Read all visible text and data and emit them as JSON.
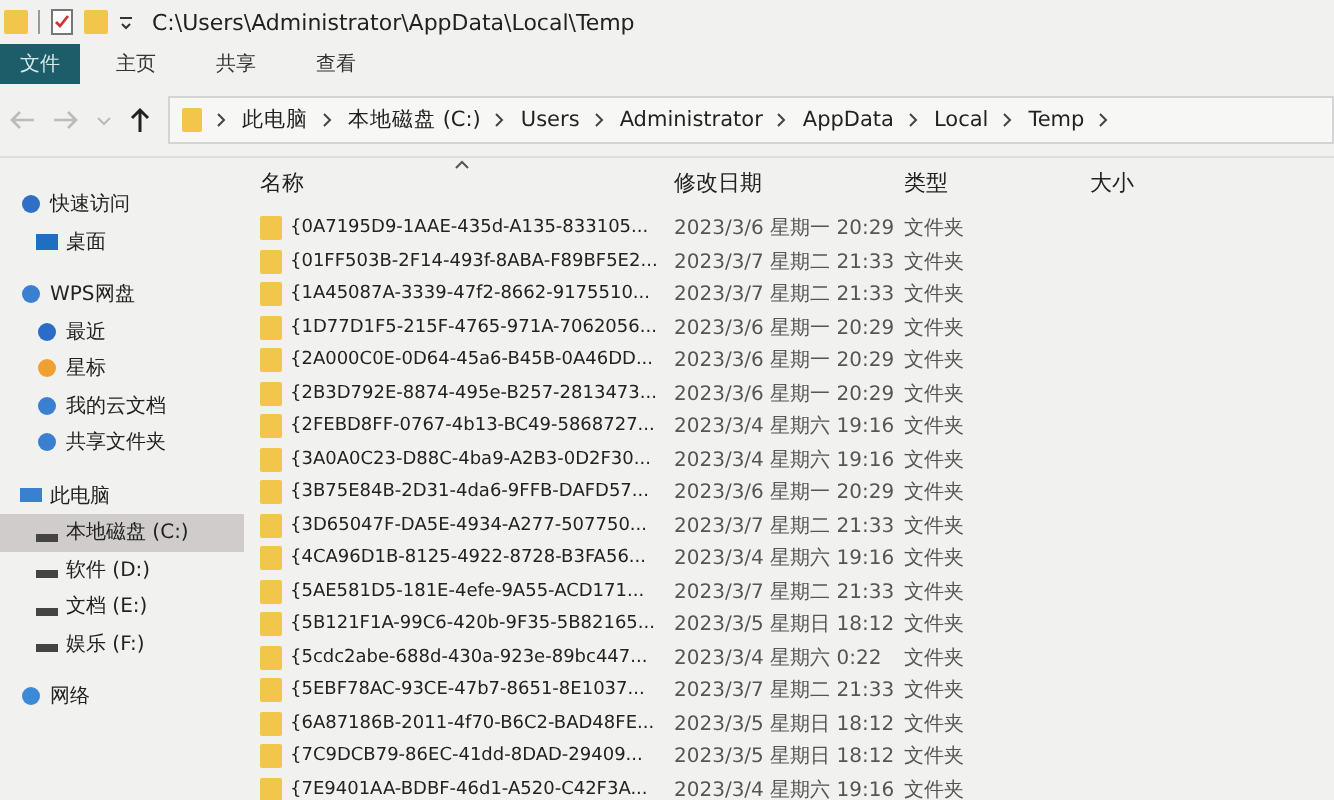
{
  "title_bar": {
    "title": "C:\\Users\\Administrator\\AppData\\Local\\Temp"
  },
  "ribbon_tabs": [
    {
      "label": "文件",
      "selected": true
    },
    {
      "label": "主页",
      "selected": false
    },
    {
      "label": "共享",
      "selected": false
    },
    {
      "label": "查看",
      "selected": false
    }
  ],
  "address_bar": {
    "segments": [
      "此电脑",
      "本地磁盘 (C:)",
      "Users",
      "Administrator",
      "AppData",
      "Local",
      "Temp"
    ]
  },
  "sidebar": [
    {
      "label": "快速访问",
      "kind": "star",
      "selected": false,
      "children": [
        {
          "label": "桌面",
          "kind": "desktop",
          "selected": false
        }
      ]
    },
    {
      "label": "WPS网盘",
      "kind": "cloud",
      "selected": false,
      "children": [
        {
          "label": "最近",
          "kind": "clock",
          "selected": false
        },
        {
          "label": "星标",
          "kind": "star-orange",
          "selected": false
        },
        {
          "label": "我的云文档",
          "kind": "cloud",
          "selected": false
        },
        {
          "label": "共享文件夹",
          "kind": "share",
          "selected": false
        }
      ]
    },
    {
      "label": "此电脑",
      "kind": "pc",
      "selected": false,
      "children": [
        {
          "label": "本地磁盘 (C:)",
          "kind": "drive",
          "selected": true
        },
        {
          "label": "软件 (D:)",
          "kind": "drive",
          "selected": false
        },
        {
          "label": "文档 (E:)",
          "kind": "drive",
          "selected": false
        },
        {
          "label": "娱乐 (F:)",
          "kind": "drive",
          "selected": false
        }
      ]
    },
    {
      "label": "网络",
      "kind": "network",
      "selected": false
    }
  ],
  "columns": [
    {
      "label": "名称",
      "sorted": true
    },
    {
      "label": "修改日期",
      "sorted": false
    },
    {
      "label": "类型",
      "sorted": false
    },
    {
      "label": "大小",
      "sorted": false
    }
  ],
  "rows": [
    {
      "name": "{0A7195D9-1AAE-435d-A135-833105...",
      "modified": "2023/3/6 星期一 20:29",
      "type": "文件夹"
    },
    {
      "name": "{01FF503B-2F14-493f-8ABA-F89BF5E2...",
      "modified": "2023/3/7 星期二 21:33",
      "type": "文件夹"
    },
    {
      "name": "{1A45087A-3339-47f2-8662-9175510...",
      "modified": "2023/3/7 星期二 21:33",
      "type": "文件夹"
    },
    {
      "name": "{1D77D1F5-215F-4765-971A-7062056...",
      "modified": "2023/3/6 星期一 20:29",
      "type": "文件夹"
    },
    {
      "name": "{2A000C0E-0D64-45a6-B45B-0A46DD...",
      "modified": "2023/3/6 星期一 20:29",
      "type": "文件夹"
    },
    {
      "name": "{2B3D792E-8874-495e-B257-2813473...",
      "modified": "2023/3/6 星期一 20:29",
      "type": "文件夹"
    },
    {
      "name": "{2FEBD8FF-0767-4b13-BC49-5868727...",
      "modified": "2023/3/4 星期六 19:16",
      "type": "文件夹"
    },
    {
      "name": "{3A0A0C23-D88C-4ba9-A2B3-0D2F30...",
      "modified": "2023/3/4 星期六 19:16",
      "type": "文件夹"
    },
    {
      "name": "{3B75E84B-2D31-4da6-9FFB-DAFD57...",
      "modified": "2023/3/6 星期一 20:29",
      "type": "文件夹"
    },
    {
      "name": "{3D65047F-DA5E-4934-A277-507750...",
      "modified": "2023/3/7 星期二 21:33",
      "type": "文件夹"
    },
    {
      "name": "{4CA96D1B-8125-4922-8728-B3FA56...",
      "modified": "2023/3/4 星期六 19:16",
      "type": "文件夹"
    },
    {
      "name": "{5AE581D5-181E-4efe-9A55-ACD171...",
      "modified": "2023/3/7 星期二 21:33",
      "type": "文件夹"
    },
    {
      "name": "{5B121F1A-99C6-420b-9F35-5B82165...",
      "modified": "2023/3/5 星期日 18:12",
      "type": "文件夹"
    },
    {
      "name": "{5cdc2abe-688d-430a-923e-89bc447...",
      "modified": "2023/3/4 星期六 0:22",
      "type": "文件夹"
    },
    {
      "name": "{5EBF78AC-93CE-47b7-8651-8E1037...",
      "modified": "2023/3/7 星期二 21:33",
      "type": "文件夹"
    },
    {
      "name": "{6A87186B-2011-4f70-B6C2-BAD48FE...",
      "modified": "2023/3/5 星期日 18:12",
      "type": "文件夹"
    },
    {
      "name": "{7C9DCB79-86EC-41dd-8DAD-29409...",
      "modified": "2023/3/5 星期日 18:12",
      "type": "文件夹"
    },
    {
      "name": "{7E9401AA-BDBF-46d1-A520-C42F3A...",
      "modified": "2023/3/4 星期六 19:16",
      "type": "文件夹"
    }
  ]
}
